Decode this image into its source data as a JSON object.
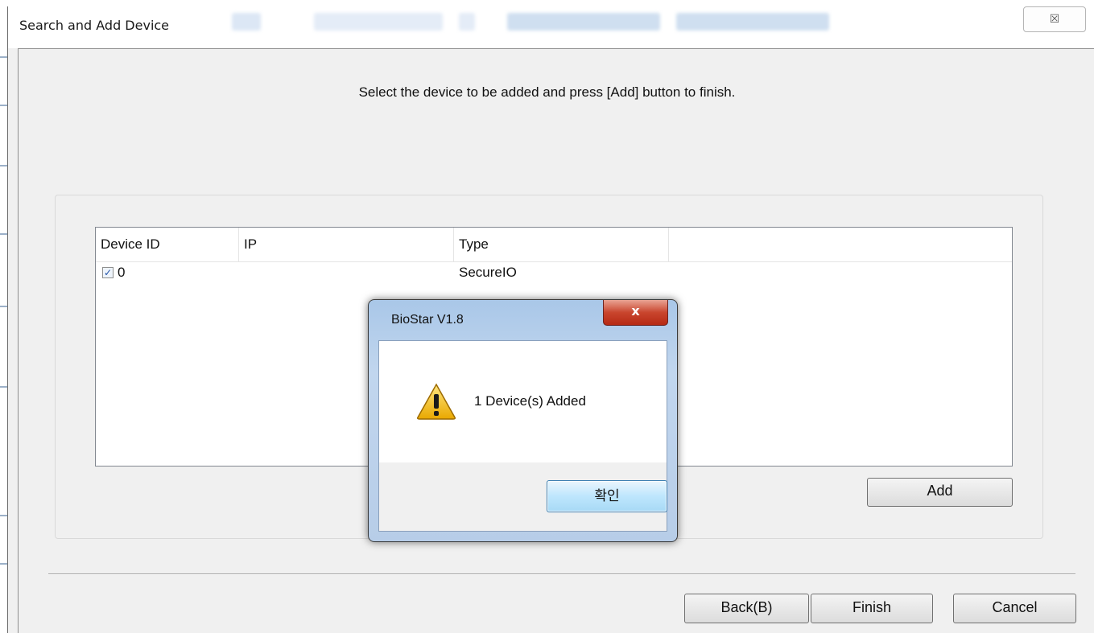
{
  "window": {
    "title": "Search and Add Device",
    "close_glyph": "☒",
    "instruction": "Select the device to be added and press [Add] button to finish."
  },
  "device_list": {
    "columns": [
      "Device ID",
      "IP",
      "Type",
      ""
    ],
    "rows": [
      {
        "checked": true,
        "check_glyph": "✓",
        "device_id": "0",
        "ip": "",
        "type": "SecureIO"
      }
    ]
  },
  "buttons": {
    "add": "Add",
    "back": "Back(B)",
    "finish": "Finish",
    "cancel": "Cancel"
  },
  "message_box": {
    "title": "BioStar V1.8",
    "close_glyph": "x",
    "message": "1 Device(s) Added",
    "ok_label": "확인",
    "icon": "warning-icon"
  },
  "colors": {
    "dialog_bg": "#f0f0f0",
    "msgbox_frame": "#b7cde8",
    "close_red": "#c9452e",
    "ok_button": "#bee6fd"
  }
}
